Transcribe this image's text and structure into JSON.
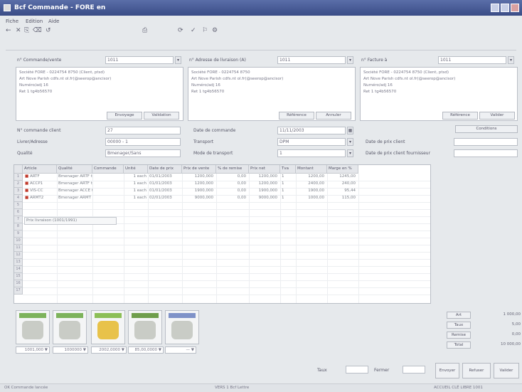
{
  "window": {
    "title": "Bcf Commande - FORE en"
  },
  "menu": [
    "Fiche",
    "Edition",
    "Aide"
  ],
  "toolbar": [
    "←",
    "✕",
    "⎘",
    "⌫",
    "↺",
    "⎙",
    "⟳",
    "✓",
    "⚐",
    "⚙"
  ],
  "sections": {
    "commande": {
      "label": "n° Commande/vente",
      "value": "1011",
      "lines": [
        "Société FORE - 0224754 8750 (Client, ptsd)",
        "Art Nove Parish cdfs.nt ol.fr(@seerop@ancisor)",
        "Numéro/adj 16",
        "Ret 1 tg4b56570"
      ],
      "btn1": "Envoyage",
      "btn2": "Validation"
    },
    "livraison": {
      "label": "n° Adresse de livraison (A)",
      "value": "1011",
      "lines": [
        "Société FORE - 0224754 8750",
        "Art Nove Parish cdfs.nt ol.fr(@seerop@ancisor)",
        "Numéro/adj 16",
        "Ret 1 tg4b56570"
      ],
      "btn1": "Référence",
      "btn2": "Annuler"
    },
    "facture": {
      "label": "n° Facture à",
      "value": "1011",
      "lines": [
        "Société FORE - 0224754 8750 (Client, ptsd)",
        "Art Nove Parish cdfs.nt ol.fr(@seerop@ancisor)",
        "Numéro/adj 16",
        "Ret 1 tg4b56570"
      ],
      "btn1": "Référence",
      "btn2": "Valider"
    }
  },
  "fields": {
    "cmd_date_label": "N° commande client",
    "cmd_date": "27",
    "date_cmd_label": "Date de commande",
    "date_cmd": "11/11/2003",
    "livr_label": "Livrer/Adresse",
    "livr": "00000 - 1",
    "transport_label": "Transport",
    "transport": "DPM",
    "statut_label": "Qualité",
    "statut": "Bmenager/Sans",
    "mode_label": "Mode de transport",
    "mode": "1",
    "conditions_btn": "Conditions",
    "cond1_label": "Date de prix client",
    "cond2_label": "Date de prix client fournisseur"
  },
  "grid": {
    "headers": [
      "",
      "Article",
      "Qualité",
      "Commande",
      "Unité",
      "Date de prix",
      "Prix de vente",
      "% de remise",
      "Prix net",
      "Tva",
      "Montant",
      "Marge en %"
    ],
    "rows": [
      [
        "■",
        "ARTF",
        "Bmenager ARTF test",
        "",
        "1 each",
        "01/01/2003",
        "1200,000",
        "0,00",
        "1200,000",
        "1",
        "1200,00",
        "1245,00"
      ],
      [
        "■",
        "ACCP1",
        "Bmenager ARTF test",
        "",
        "1 each",
        "01/01/2003",
        "1200,000",
        "0,00",
        "1200,000",
        "1",
        "2400,00",
        "240,00"
      ],
      [
        "■",
        "VIS-CC",
        "Bmenager ACCE test",
        "",
        "1 each",
        "01/01/2003",
        "1900,000",
        "0,00",
        "1900,000",
        "1",
        "1900,00",
        "95,44"
      ],
      [
        "■",
        "ARMT2",
        "Bmenager ARMT 2.0",
        "",
        "1 each",
        "02/01/2003",
        "9000,000",
        "0,00",
        "9000,000",
        "1",
        "1000,00",
        "115,00"
      ]
    ],
    "note": "Prix livraison (1001/1991)",
    "row_numbers": [
      "1",
      "2",
      "3",
      "4",
      "5",
      "6",
      "7",
      "8",
      "9",
      "10",
      "11",
      "12",
      "13",
      "14",
      "15",
      "16",
      "17"
    ]
  },
  "stamps": [
    {
      "value": "1001,000 ▼",
      "color": "#7db35b"
    },
    {
      "value": "1000000 ▼",
      "color": "#7db35b"
    },
    {
      "value": "2002,0000 ▼",
      "color": "#8cbf57"
    },
    {
      "value": "85,00,0000 ▼",
      "color": "#6f9e4c"
    },
    {
      "value": "— ▼",
      "color": "#7f92c8"
    }
  ],
  "summary": {
    "btn_art": "Art",
    "btn_taux": "Taux",
    "btn_remise": "Remise",
    "btn_total": "Total",
    "val1": "1 000,00",
    "val2": "5,00",
    "val3": "0,00",
    "val4": "10 000,00",
    "paiement_label": "Taux",
    "paiement": "Fermer",
    "btn_envoi": "Envoyer",
    "btn_refuser": "Refuser",
    "btn_valider": "Valider"
  },
  "status": {
    "left": "OK Commande lancée",
    "center": "VERS 1 Bcf Lettre",
    "right": "ACCUEIL CLÉ LIBRE 1001"
  },
  "colors": {
    "titlebar": "#4a5d9a"
  }
}
